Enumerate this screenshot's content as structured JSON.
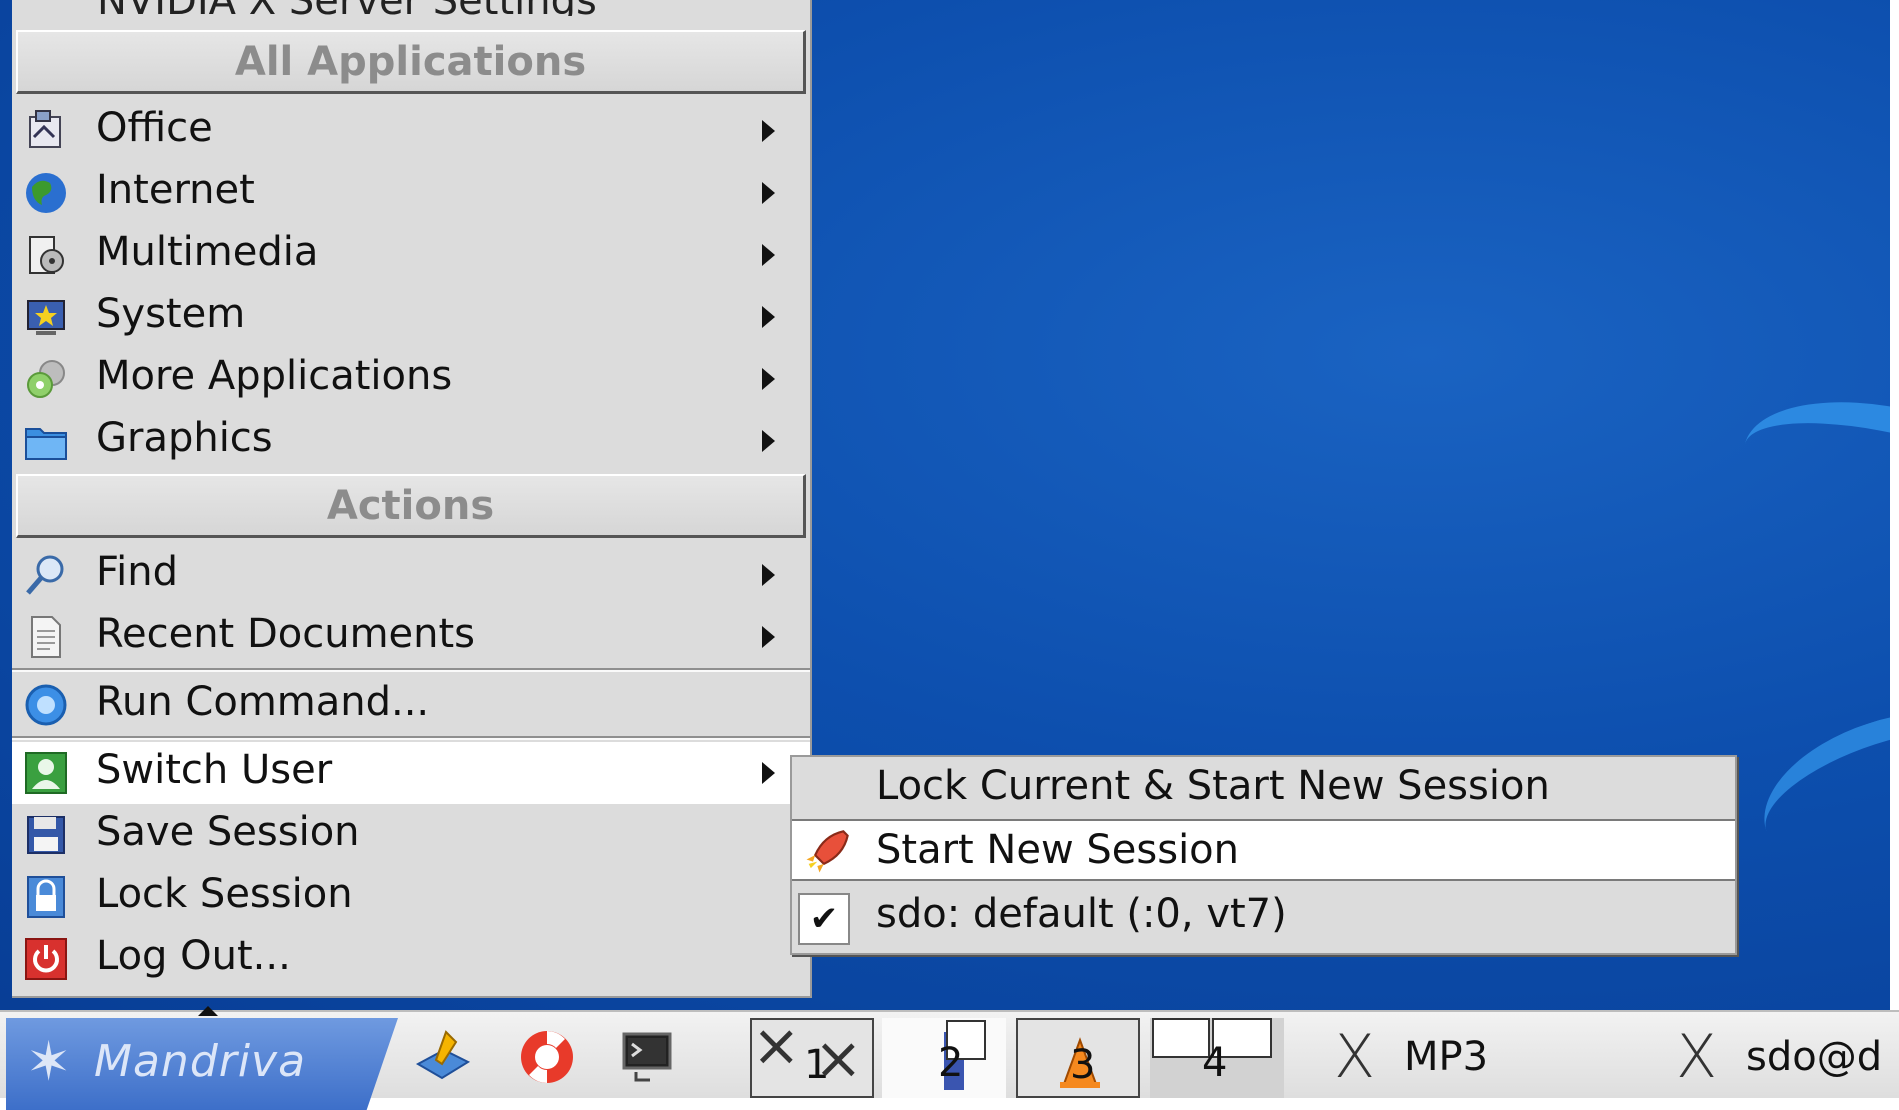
{
  "menu": {
    "partial_top_label": "NVIDIA X Server Settings",
    "sections": [
      {
        "title": "All Applications"
      },
      {
        "title": "Actions"
      }
    ],
    "applications": [
      {
        "label": "Office",
        "icon": "office-icon",
        "submenu": true
      },
      {
        "label": "Internet",
        "icon": "globe-icon",
        "submenu": true
      },
      {
        "label": "Multimedia",
        "icon": "multimedia-icon",
        "submenu": true
      },
      {
        "label": "System",
        "icon": "system-icon",
        "submenu": true
      },
      {
        "label": "More Applications",
        "icon": "gears-icon",
        "submenu": true
      },
      {
        "label": "Graphics",
        "icon": "folder-icon",
        "submenu": true
      }
    ],
    "actions": [
      {
        "label": "Find",
        "icon": "magnifier-icon",
        "submenu": true
      },
      {
        "label": "Recent Documents",
        "icon": "document-icon",
        "submenu": true
      }
    ],
    "run_command": {
      "label": "Run Command...",
      "icon": "run-icon"
    },
    "session": [
      {
        "label": "Switch User",
        "icon": "switch-user-icon",
        "submenu": true,
        "highlighted": true
      },
      {
        "label": "Save Session",
        "icon": "floppy-icon",
        "submenu": false
      },
      {
        "label": "Lock Session",
        "icon": "lock-icon",
        "submenu": false
      },
      {
        "label": "Log Out...",
        "icon": "power-icon",
        "submenu": false
      }
    ]
  },
  "switch_user_submenu": [
    {
      "label": "Lock Current & Start New Session",
      "icon": "",
      "highlighted": false
    },
    {
      "label": "Start New Session",
      "icon": "rocket-icon",
      "highlighted": true
    },
    {
      "label": "sdo: default (:0, vt7)",
      "icon": "check-icon",
      "highlighted": false
    }
  ],
  "taskbar": {
    "start_label": "Mandriva",
    "launchers": [
      "desktop-icon",
      "lifebuoy-icon",
      "terminal-icon"
    ],
    "workspaces": [
      "1",
      "2",
      "3",
      "4"
    ],
    "tasks": [
      {
        "label": "MP3"
      },
      {
        "label": "sdo@d"
      }
    ]
  },
  "colors": {
    "menu_bg": "#dcdcdc",
    "section_text": "#8c8c8c",
    "desktop": "#0d4fae",
    "highlight": "#ffffff"
  }
}
